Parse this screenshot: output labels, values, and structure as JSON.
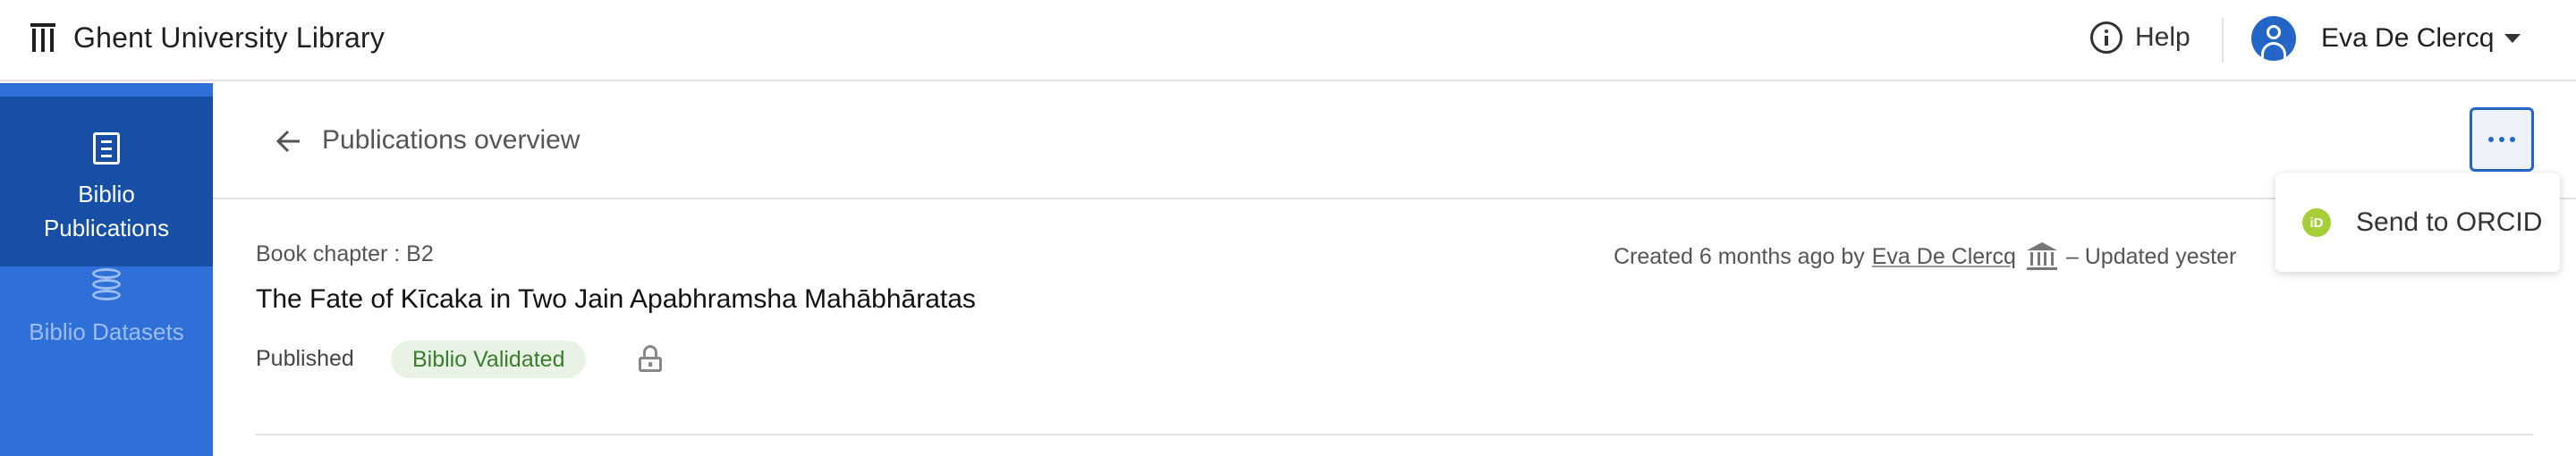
{
  "app": {
    "title": "Ghent University Library"
  },
  "header": {
    "help_label": "Help",
    "user_name": "Eva De Clercq"
  },
  "sidebar": {
    "items": [
      {
        "label": "Biblio Publications",
        "icon": "document-icon",
        "active": true
      },
      {
        "label": "Biblio Datasets",
        "icon": "database-icon",
        "active": false
      }
    ]
  },
  "main": {
    "back_label": "Publications overview",
    "more_menu": {
      "items": [
        {
          "label": "Send to ORCID",
          "icon": "orcid-icon"
        }
      ]
    },
    "publication": {
      "type": "Book chapter : B2",
      "title": "The Fate of Kīcaka in Two Jain Apabhramsha Mahābhāratas",
      "status": "Published",
      "badge": "Biblio Validated",
      "meta_created": "Created 6 months ago by",
      "meta_creator": "Eva De Clercq",
      "meta_updated": "– Updated yester"
    }
  },
  "colors": {
    "sidebar_bg": "#2e6fd8",
    "sidebar_active_bg": "#174ea6",
    "accent": "#2466c8",
    "badge_bg": "#e8f3e6",
    "badge_text": "#3a7d2c",
    "orcid": "#a6ce39"
  }
}
